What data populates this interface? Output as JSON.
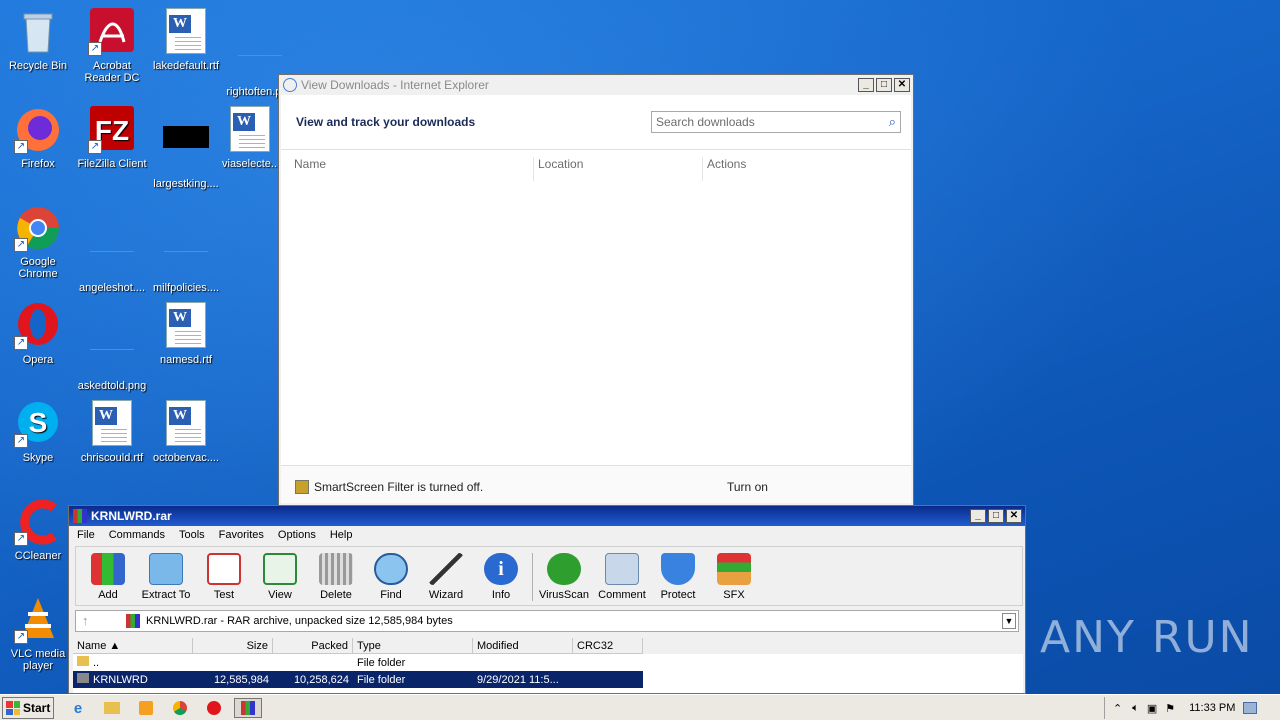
{
  "desktop": {
    "icons": [
      {
        "label": "Recycle Bin"
      },
      {
        "label": "Acrobat Reader DC"
      },
      {
        "label": "lakedefault.rtf"
      },
      {
        "label": "rightoften.png"
      },
      {
        "label": "Firefox"
      },
      {
        "label": "FileZilla Client"
      },
      {
        "label": "largestking...."
      },
      {
        "label": "viaselecte..."
      },
      {
        "label": "Google Chrome"
      },
      {
        "label": "angeleshot...."
      },
      {
        "label": "milfpolicies...."
      },
      {
        "label": "Opera"
      },
      {
        "label": "askedtold.png"
      },
      {
        "label": "namesd.rtf"
      },
      {
        "label": "Skype"
      },
      {
        "label": "chriscould.rtf"
      },
      {
        "label": "octobervac...."
      },
      {
        "label": "CCleaner"
      },
      {
        "label": "VLC media player"
      }
    ]
  },
  "ie_window": {
    "title": "View Downloads - Internet Explorer",
    "heading": "View and track your downloads",
    "search_placeholder": "Search downloads",
    "columns": [
      "Name",
      "Location",
      "Actions"
    ],
    "smartscreen_text": "SmartScreen Filter is turned off.",
    "turn_on_label": "Turn on"
  },
  "rar_window": {
    "title": "KRNLWRD.rar",
    "menu": [
      "File",
      "Commands",
      "Tools",
      "Favorites",
      "Options",
      "Help"
    ],
    "tools": [
      {
        "label": "Add",
        "icon": "add-icon"
      },
      {
        "label": "Extract To",
        "icon": "extract-icon"
      },
      {
        "label": "Test",
        "icon": "test-icon"
      },
      {
        "label": "View",
        "icon": "view-icon"
      },
      {
        "label": "Delete",
        "icon": "delete-icon"
      },
      {
        "label": "Find",
        "icon": "find-icon"
      },
      {
        "label": "Wizard",
        "icon": "wizard-icon"
      },
      {
        "label": "Info",
        "icon": "info-icon"
      },
      {
        "label": "VirusScan",
        "icon": "virusscan-icon"
      },
      {
        "label": "Comment",
        "icon": "comment-icon"
      },
      {
        "label": "Protect",
        "icon": "protect-icon"
      },
      {
        "label": "SFX",
        "icon": "sfx-icon"
      }
    ],
    "address": "KRNLWRD.rar - RAR archive, unpacked size 12,585,984 bytes",
    "columns": [
      "Name",
      "Size",
      "Packed",
      "Type",
      "Modified",
      "CRC32"
    ],
    "rows": [
      {
        "name": "..",
        "size": "",
        "packed": "",
        "type": "File folder",
        "modified": "",
        "crc": ""
      },
      {
        "name": "KRNLWRD",
        "size": "12,585,984",
        "packed": "10,258,624",
        "type": "File folder",
        "modified": "9/29/2021 11:5...",
        "crc": ""
      }
    ]
  },
  "taskbar": {
    "start_label": "Start",
    "clock": "11:33 PM"
  },
  "watermark": "ANY RUN"
}
